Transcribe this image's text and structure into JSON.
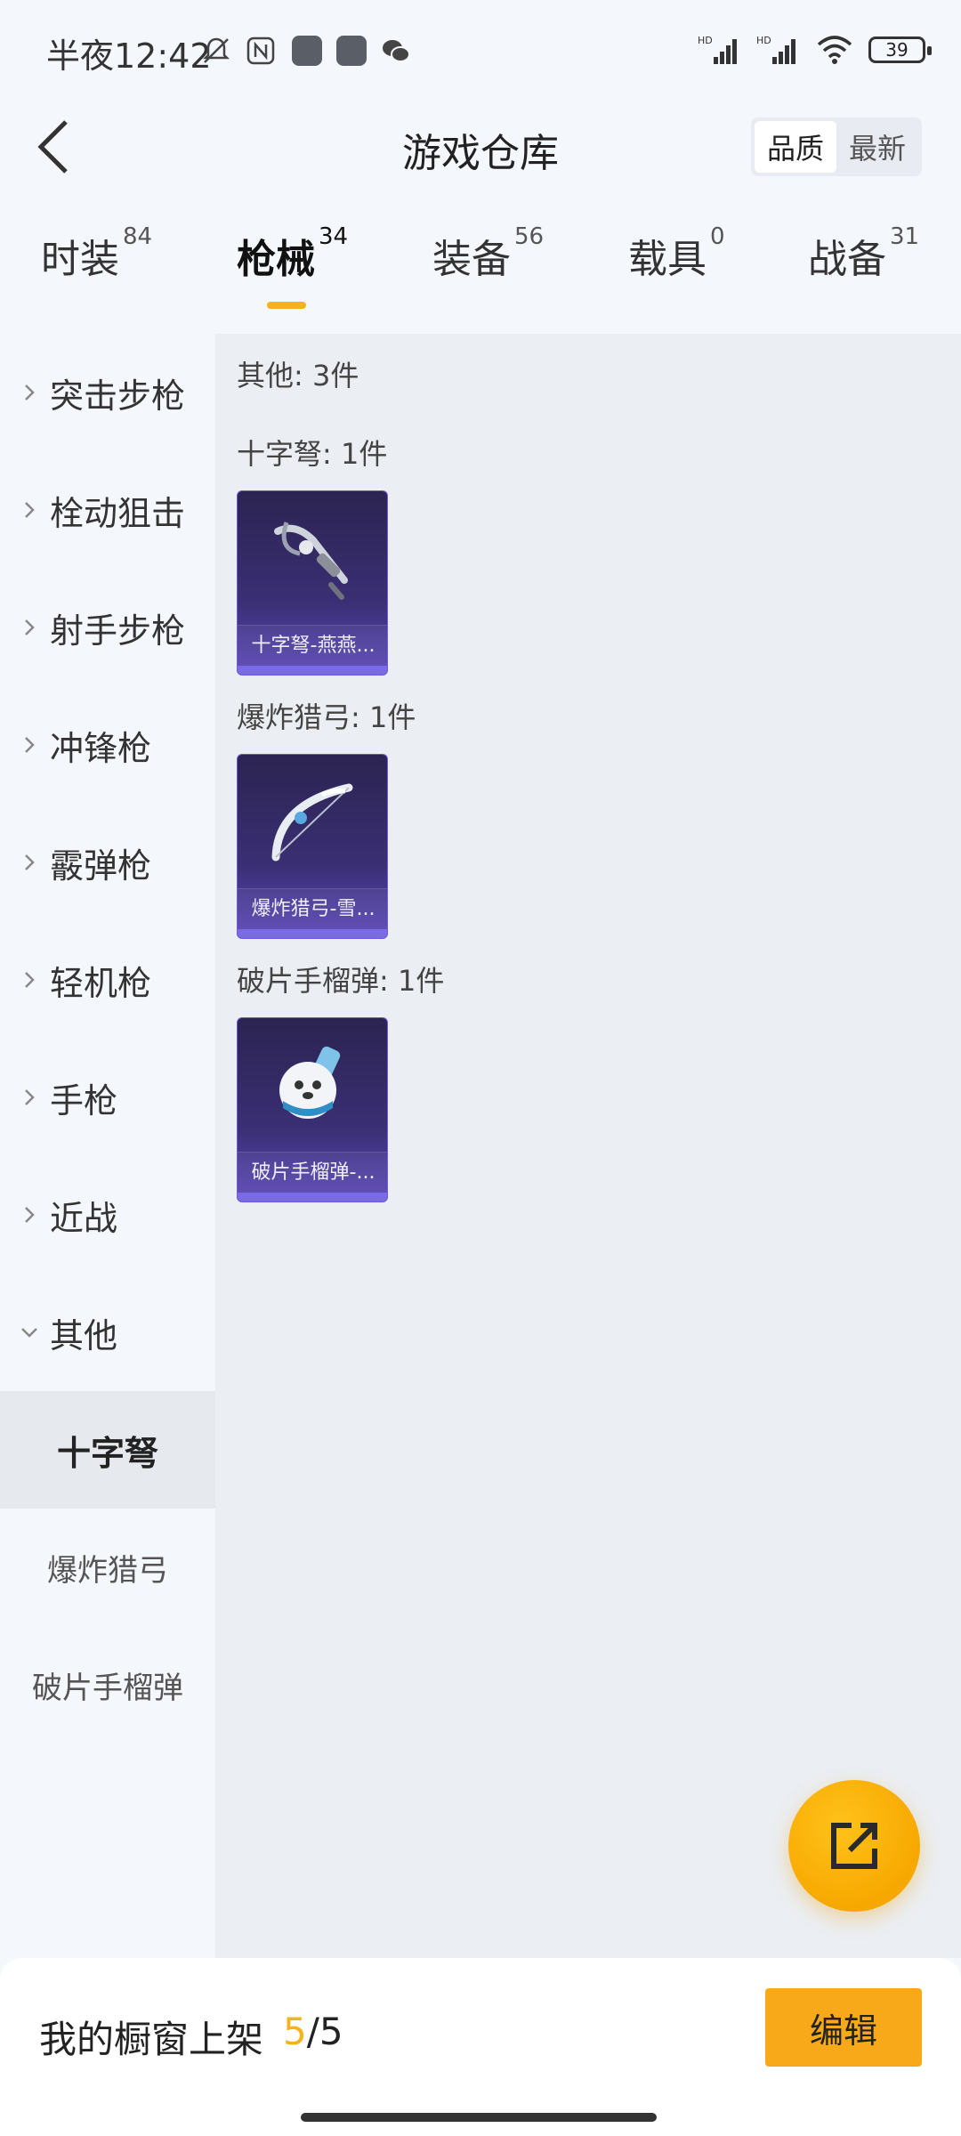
{
  "status_bar": {
    "time": "半夜12:42",
    "battery": "39",
    "icons": [
      "bell-off-icon",
      "nfc-icon",
      "app-icon",
      "app-icon",
      "wechat-icon",
      "hd-signal-icon",
      "hd-signal-icon",
      "wifi-icon",
      "battery-icon"
    ]
  },
  "header": {
    "title": "游戏仓库",
    "sort_options": [
      "品质",
      "最新"
    ],
    "sort_selected": "品质"
  },
  "tabs": [
    {
      "label": "时装",
      "count": "84"
    },
    {
      "label": "枪械",
      "count": "34",
      "active": true
    },
    {
      "label": "装备",
      "count": "56"
    },
    {
      "label": "载具",
      "count": "0"
    },
    {
      "label": "战备",
      "count": "31"
    }
  ],
  "sidebar": {
    "categories": [
      "突击步枪",
      "栓动狙击",
      "射手步枪",
      "冲锋枪",
      "霰弹枪",
      "轻机枪",
      "手枪",
      "近战",
      "其他"
    ],
    "expanded": "其他",
    "subitems": [
      "十字弩",
      "爆炸猎弓",
      "破片手榴弹"
    ],
    "selected_sub": "十字弩"
  },
  "content": {
    "summary": "其他: 3件",
    "sections": [
      {
        "heading": "十字弩: 1件",
        "item_name": "十字弩-燕燕...",
        "art": "crossbow-icon"
      },
      {
        "heading": "爆炸猎弓: 1件",
        "item_name": "爆炸猎弓-雪...",
        "art": "bow-icon"
      },
      {
        "heading": "破片手榴弹: 1件",
        "item_name": "破片手榴弹-...",
        "art": "grenade-icon"
      }
    ]
  },
  "bottom": {
    "label": "我的橱窗上架",
    "current": "5",
    "separator": "/",
    "total": "5",
    "edit_label": "编辑"
  },
  "colors": {
    "accent": "#f5b21c",
    "card_bg": "#3a2f74",
    "fab": "#f7a800"
  }
}
